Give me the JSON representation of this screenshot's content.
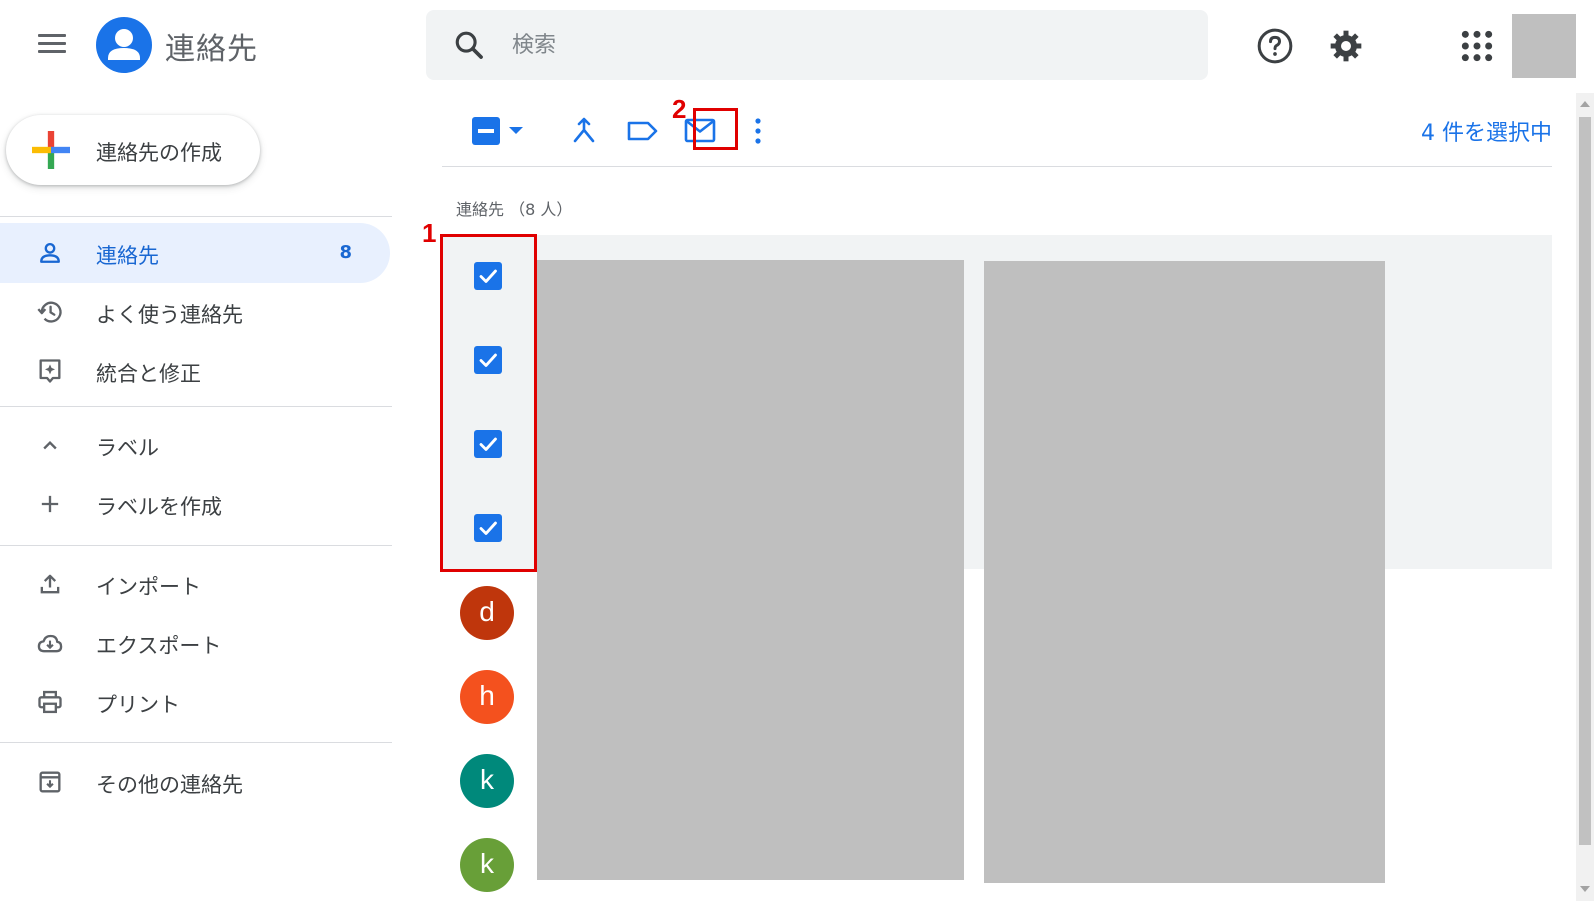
{
  "app": {
    "title": "連絡先"
  },
  "search": {
    "placeholder": "検索"
  },
  "sidebar": {
    "create_label": "連絡先の作成",
    "items": [
      {
        "label": "連絡先",
        "count": "8",
        "icon": "person-icon"
      },
      {
        "label": "よく使う連絡先",
        "icon": "history-icon"
      },
      {
        "label": "統合と修正",
        "icon": "merge-fix-icon"
      },
      {
        "label": "ラベル",
        "icon": "chevron-up-icon"
      },
      {
        "label": "ラベルを作成",
        "icon": "plus-icon"
      },
      {
        "label": "インポート",
        "icon": "upload-icon"
      },
      {
        "label": "エクスポート",
        "icon": "cloud-download-icon"
      },
      {
        "label": "プリント",
        "icon": "print-icon"
      },
      {
        "label": "その他の連絡先",
        "icon": "archive-icon"
      }
    ]
  },
  "toolbar": {
    "selected_text": "4 件を選択中"
  },
  "annotations": {
    "one": "1",
    "two": "2"
  },
  "list": {
    "header": "連絡先 （8 人）",
    "avatars": [
      {
        "letter": "d",
        "color": "#bf360c"
      },
      {
        "letter": "h",
        "color": "#f4511e"
      },
      {
        "letter": "k",
        "color": "#00897b"
      },
      {
        "letter": "k",
        "color": "#689f38"
      }
    ]
  },
  "colors": {
    "accent": "#1a73e8",
    "annotation": "#e00000"
  }
}
